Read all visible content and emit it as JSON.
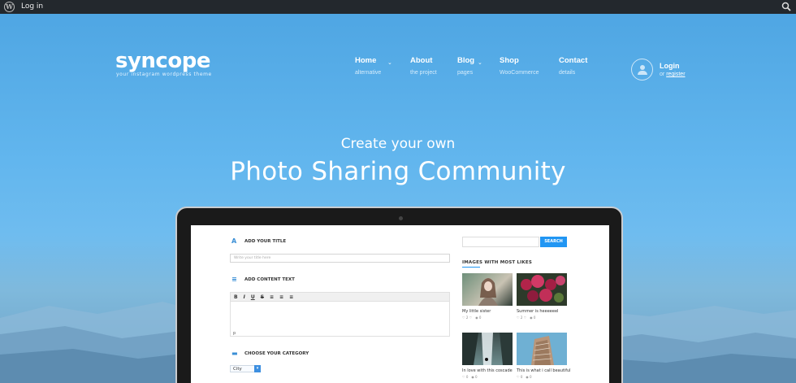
{
  "admin_bar": {
    "wp_glyph": "W",
    "login_label": "Log in"
  },
  "brand": {
    "name": "syncope",
    "tagline": "your instagram wordpress theme"
  },
  "nav": [
    {
      "title": "Home",
      "subtitle": "alternative",
      "has_dropdown": true
    },
    {
      "title": "About",
      "subtitle": "the project",
      "has_dropdown": false
    },
    {
      "title": "Blog",
      "subtitle": "pages",
      "has_dropdown": true
    },
    {
      "title": "Shop",
      "subtitle": "WooCommerce",
      "has_dropdown": false
    },
    {
      "title": "Contact",
      "subtitle": "details",
      "has_dropdown": false
    }
  ],
  "account": {
    "login_label": "Login",
    "or_text": "or",
    "register_label": "register"
  },
  "hero": {
    "subtitle": "Create your own",
    "title": "Photo Sharing Community"
  },
  "editor": {
    "title_label": "ADD YOUR TITLE",
    "title_placeholder": "Write your title here",
    "content_label": "ADD CONTENT TEXT",
    "toolbar": [
      "B",
      "I",
      "U",
      "S",
      "≡",
      "≡",
      "≡"
    ],
    "path_tag": "p",
    "category_label": "CHOOSE YOUR CATEGORY",
    "category_value": "City"
  },
  "sidebar": {
    "search_button": "SEARCH",
    "widget_title": "IMAGES WITH MOST LIKES",
    "images": [
      {
        "caption": "My little sister",
        "likes": "2 ♡",
        "comments": "0"
      },
      {
        "caption": "Summer is heeeeeel",
        "likes": "2 ♡",
        "comments": "0"
      },
      {
        "caption": "In love with this coscade",
        "likes": "0",
        "comments": "0"
      },
      {
        "caption": "This is what i call beautiful",
        "likes": "0",
        "comments": "0"
      }
    ]
  },
  "colors": {
    "accent": "#2196f3",
    "admin_bar": "#23282d"
  }
}
